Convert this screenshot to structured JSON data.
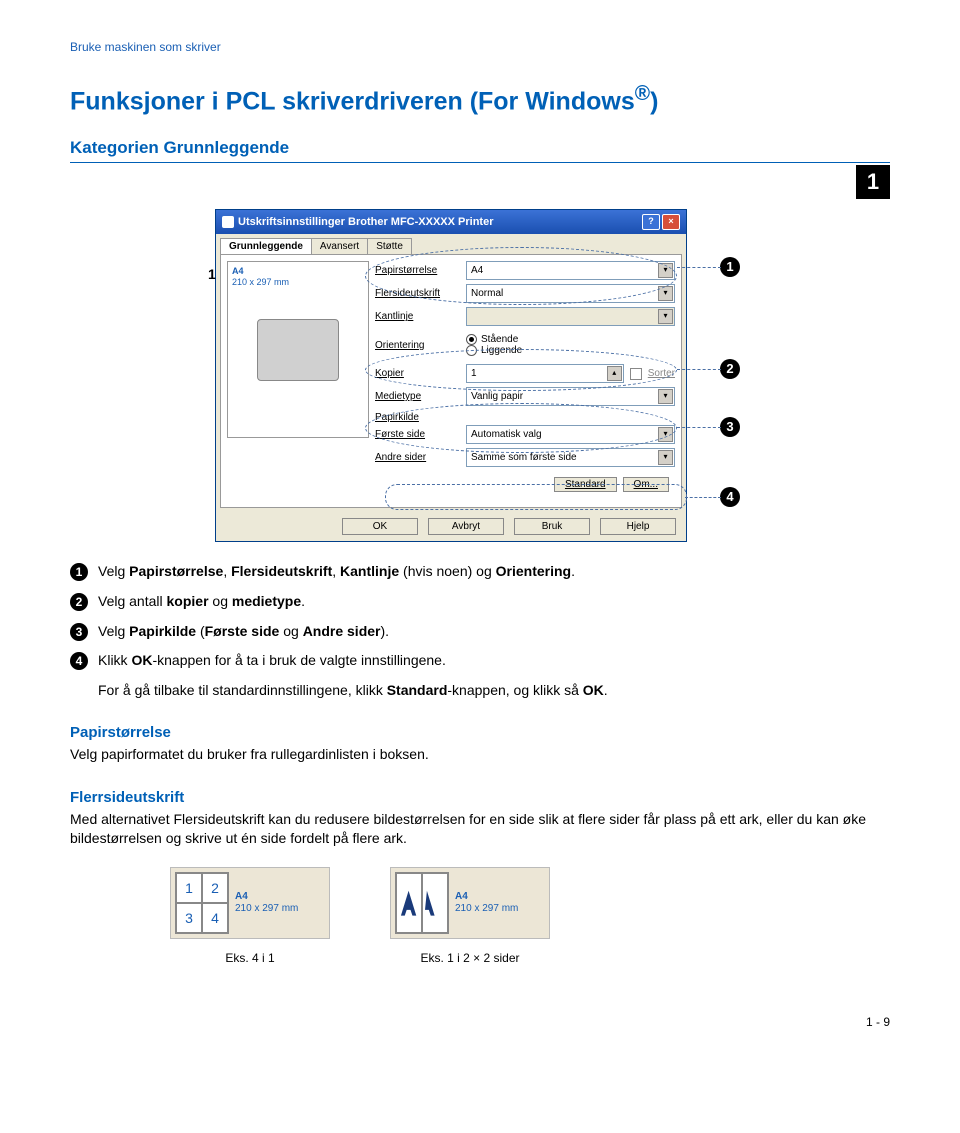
{
  "header": "Bruke maskinen som skriver",
  "title_pre": "Funksjoner i PCL skriverdriveren (For Windows",
  "title_sup": "®",
  "title_post": ")",
  "subtitle": "Kategorien Grunnleggende",
  "chapter": "1",
  "dialog": {
    "title": "Utskriftsinnstillinger Brother MFC-XXXXX Printer",
    "tabs": [
      "Grunnleggende",
      "Avansert",
      "Støtte"
    ],
    "preview": {
      "label_paper": "A4",
      "label_size": "210 x 297 mm",
      "marker": "1"
    },
    "rows": {
      "papirstorrelse": {
        "label": "Papirstørrelse",
        "value": "A4"
      },
      "flersideutskrift": {
        "label": "Flersideutskrift",
        "value": "Normal"
      },
      "kantlinje": {
        "label": "Kantlinje",
        "value": ""
      },
      "orienteringLabel": "Orientering",
      "orientering": {
        "opt1": "Stående",
        "opt2": "Liggende"
      },
      "kopier": {
        "label": "Kopier",
        "value": "1",
        "sorter": "Sorter"
      },
      "medietype": {
        "label": "Medietype",
        "value": "Vanlig papir"
      },
      "papirkilde": "Papirkilde",
      "forsteSide": {
        "label": "Første side",
        "value": "Automatisk valg"
      },
      "andreSider": {
        "label": "Andre sider",
        "value": "Samme som første side"
      }
    },
    "smallButtons": {
      "standard": "Standard",
      "om": "Om..."
    },
    "buttons": {
      "ok": "OK",
      "avbryt": "Avbryt",
      "bruk": "Bruk",
      "hjelp": "Hjelp"
    }
  },
  "callouts": {
    "one": "1",
    "two": "2",
    "three": "3",
    "four": "4"
  },
  "steps": {
    "s1_a": "Velg ",
    "s1_b1": "Papirstørrelse",
    "s1_b2": "Flersideutskrift",
    "s1_b3": "Kantlinje",
    "s1_c": " (hvis noen) og ",
    "s1_b4": "Orientering",
    "s1_end": ".",
    "s2_a": "Velg antall ",
    "s2_b1": "kopier",
    "s2_c": " og ",
    "s2_b2": "medietype",
    "s2_end": ".",
    "s3_a": "Velg ",
    "s3_b1": "Papirkilde",
    "s3_c": " (",
    "s3_b2": "Første side",
    "s3_d": " og ",
    "s3_b3": "Andre sider",
    "s3_end": ").",
    "s4_a": "Klikk ",
    "s4_b1": "OK",
    "s4_c": "-knappen for å ta i bruk de valgte innstillingene.",
    "s4line2_a": "For å gå tilbake til standardinnstillingene, klikk ",
    "s4line2_b": "Standard",
    "s4line2_c": "-knappen, og klikk så ",
    "s4line2_d": "OK",
    "s4line2_end": "."
  },
  "section1_h": "Papirstørrelse",
  "section1_body": "Velg papirformatet du bruker fra rullegardinlisten i boksen.",
  "section2_h": "Flerrsideutskrift",
  "section2_body": "Med alternativet Flersideutskrift kan du redusere bildestørrelsen for en side slik at flere sider får plass på ett ark, eller du kan øke bildestørrelsen og skrive ut én side fordelt på flere ark.",
  "examples": {
    "info_paper": "A4",
    "info_size": "210 x 297 mm",
    "cells": [
      "1",
      "2",
      "3",
      "4"
    ],
    "cap1": "Eks. 4 i 1",
    "cap2": "Eks. 1 i 2 × 2 sider"
  },
  "pageNum": "1 - 9"
}
